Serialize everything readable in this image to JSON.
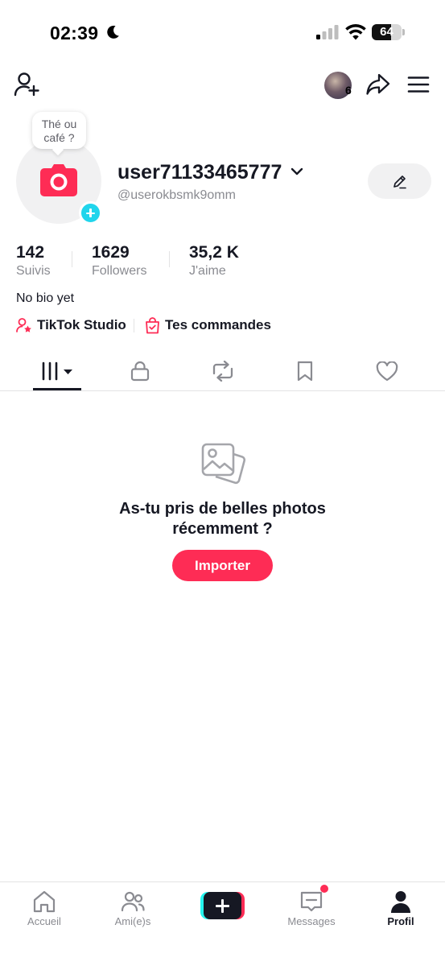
{
  "status_bar": {
    "time": "02:39",
    "battery": "64",
    "battery_fraction": 0.64,
    "icons": [
      "moon-icon",
      "signal-icon",
      "wifi-icon",
      "battery-icon"
    ]
  },
  "top_nav": {
    "story_count": "6",
    "icons": [
      "add-friend-icon",
      "share-icon",
      "menu-icon"
    ]
  },
  "profile": {
    "bubble_line1": "Thé ou",
    "bubble_line2": "café ?",
    "username": "user71133465777",
    "handle": "@userokbsmk9omm",
    "bio": "No bio yet"
  },
  "stats": [
    {
      "value": "142",
      "label": "Suivis"
    },
    {
      "value": "1629",
      "label": "Followers"
    },
    {
      "value": "35,2 K",
      "label": "J'aime"
    }
  ],
  "links": {
    "studio": "TikTok Studio",
    "orders": "Tes commandes"
  },
  "tabs": [
    "videos-tab",
    "private-tab",
    "reposts-tab",
    "favorites-tab",
    "liked-tab"
  ],
  "empty_state": {
    "title_line1": "As-tu pris de belles photos",
    "title_line2": "récemment ?",
    "button": "Importer"
  },
  "bottom_nav": {
    "home": "Accueil",
    "friends": "Ami(e)s",
    "messages": "Messages",
    "profile": "Profil"
  },
  "colors": {
    "accent": "#fe2c55",
    "cyan": "#20d5ec",
    "text": "#161823",
    "muted": "#8a8b91"
  }
}
